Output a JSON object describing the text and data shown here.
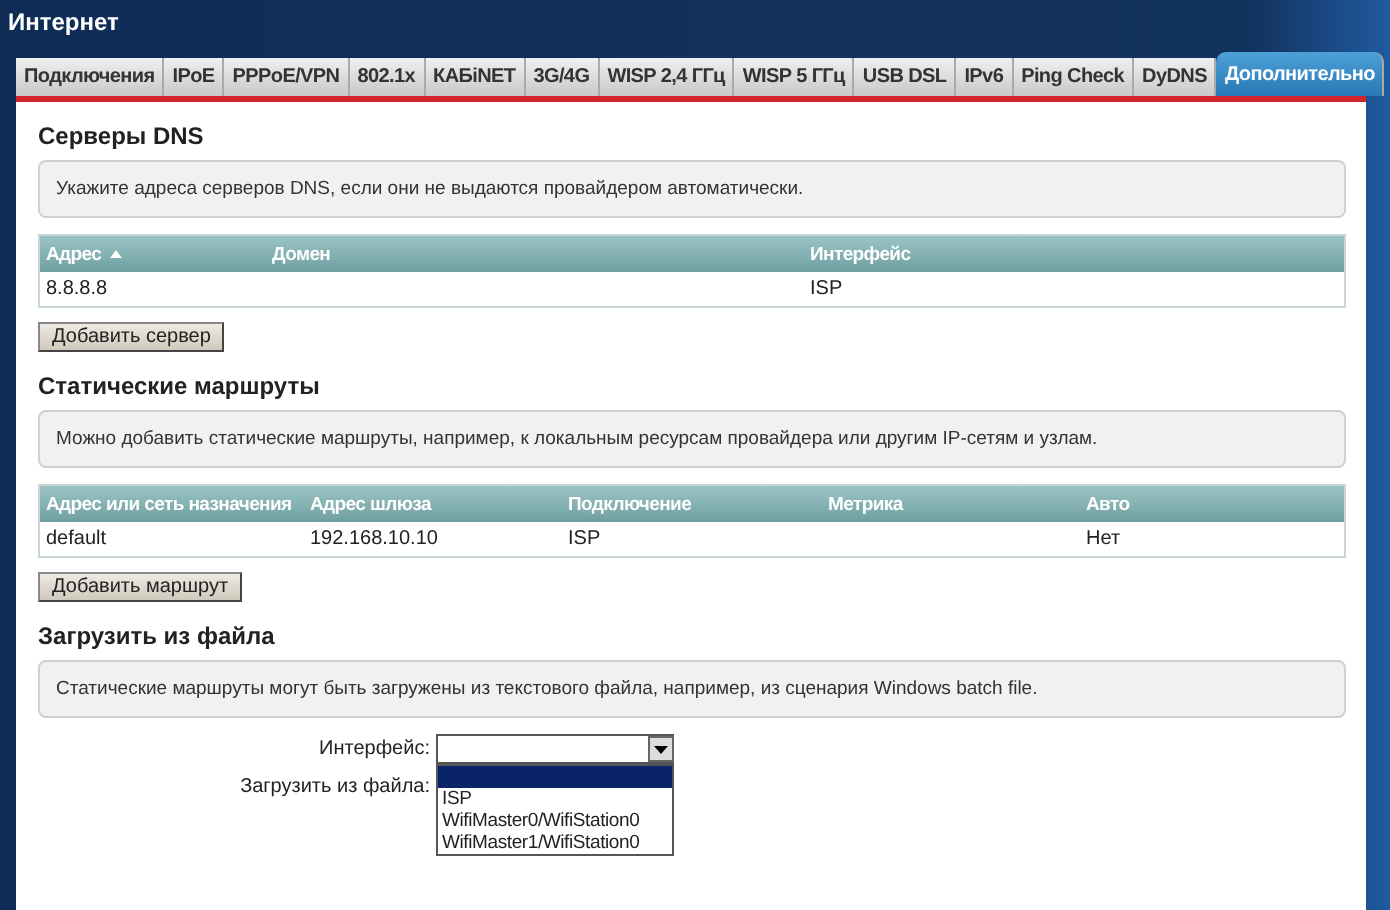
{
  "window": {
    "title": "Интернет"
  },
  "tabs": [
    {
      "label": "Подключения",
      "selected": false
    },
    {
      "label": "IPoE",
      "selected": false
    },
    {
      "label": "PPPoE/VPN",
      "selected": false
    },
    {
      "label": "802.1x",
      "selected": false
    },
    {
      "label": "КАБiNET",
      "selected": false
    },
    {
      "label": "3G/4G",
      "selected": false
    },
    {
      "label": "WISP 2,4 ГГц",
      "selected": false
    },
    {
      "label": "WISP 5 ГГц",
      "selected": false
    },
    {
      "label": "USB DSL",
      "selected": false
    },
    {
      "label": "IPv6",
      "selected": false
    },
    {
      "label": "Ping Check",
      "selected": false
    },
    {
      "label": "DyDNS",
      "selected": false
    },
    {
      "label": "Дополнительно",
      "selected": true
    }
  ],
  "dns": {
    "heading": "Серверы DNS",
    "info": "Укажите адреса серверов DNS, если они не выдаются провайдером автоматически.",
    "columns": [
      {
        "label": "Адрес",
        "sorted": true
      },
      {
        "label": "Домен",
        "sorted": false
      },
      {
        "label": "Интерфейс",
        "sorted": false
      }
    ],
    "rows": [
      [
        "8.8.8.8",
        "",
        "ISP"
      ]
    ],
    "button": "Добавить сервер"
  },
  "routes": {
    "heading": "Статические маршруты",
    "info": "Можно добавить статические маршруты, например, к локальным ресурсам провайдера или другим IP-сетям и узлам.",
    "columns": [
      {
        "label": "Адрес или сеть назначения",
        "sorted": false
      },
      {
        "label": "Адрес шлюза",
        "sorted": false
      },
      {
        "label": "Подключение",
        "sorted": false
      },
      {
        "label": "Метрика",
        "sorted": false
      },
      {
        "label": "Авто",
        "sorted": false
      }
    ],
    "rows": [
      [
        "default",
        "192.168.10.10",
        "ISP",
        "",
        "Нет"
      ]
    ],
    "button": "Добавить маршрут"
  },
  "upload": {
    "heading": "Загрузить из файла",
    "info": "Статические маршруты могут быть загружены из текстового файла, например, из сценария Windows batch file.",
    "interface_label": "Интерфейс:",
    "file_label": "Загрузить из файла:",
    "dropdown_expanded": true,
    "options": [
      {
        "selected": true
      },
      {
        "label": "ISP",
        "selected": false
      },
      {
        "label": "WifiMaster0/WifiStation0",
        "selected": false
      },
      {
        "label": "WifiMaster1/WifiStation0",
        "selected": false
      }
    ]
  }
}
